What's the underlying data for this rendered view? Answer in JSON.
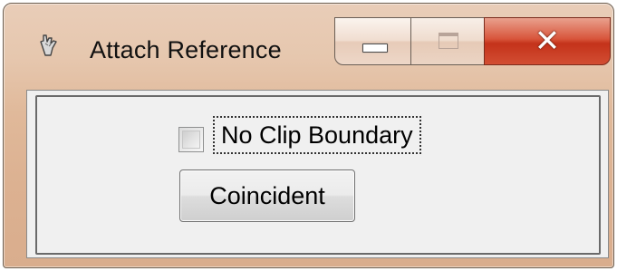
{
  "window": {
    "title": "Attach Reference",
    "icon": "app-icon",
    "controls": {
      "minimize_icon": "minimize-icon",
      "maximize_icon": "maximize-icon",
      "close_icon": "close-icon",
      "close_glyph": "✕"
    }
  },
  "dialog": {
    "no_clip_boundary": {
      "label": "No Clip Boundary",
      "checked": false
    },
    "coincident_button": {
      "label": "Coincident"
    }
  },
  "colors": {
    "title_bar": "#e6c7ae",
    "close_button": "#c4321a",
    "client_background": "#f0f0f0"
  }
}
